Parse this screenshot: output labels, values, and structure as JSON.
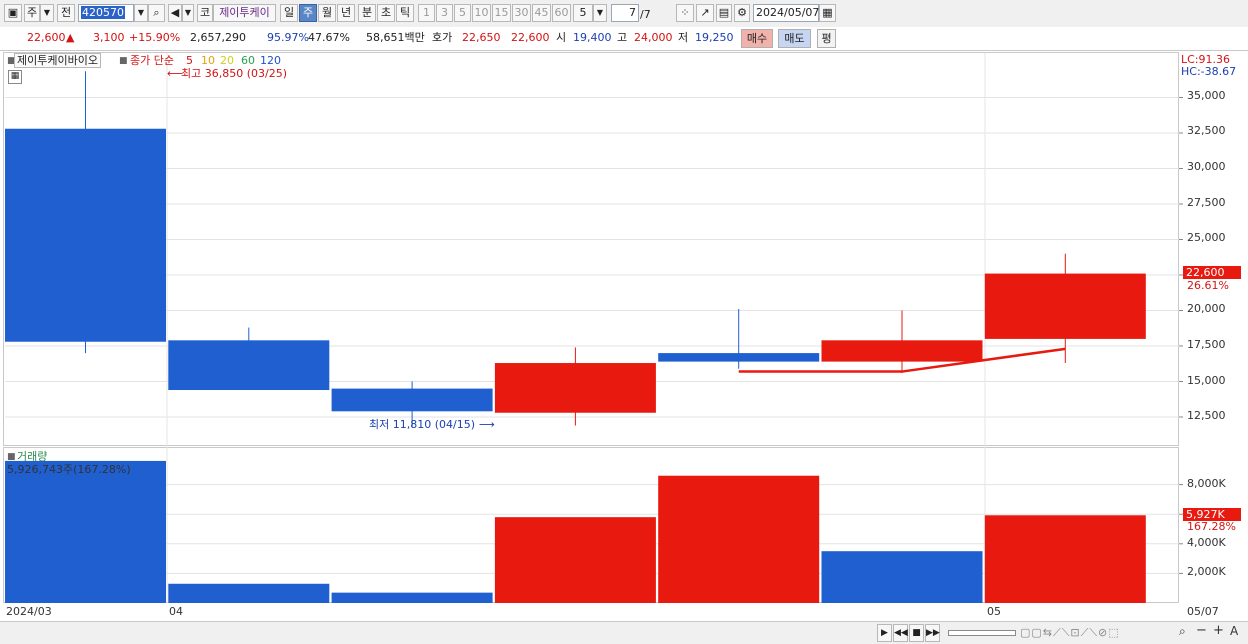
{
  "toolbar": {
    "period_week": "주",
    "all": "전",
    "code": "420570",
    "market": "코",
    "name": "제이투케이",
    "tabs": [
      "일",
      "주",
      "월",
      "년",
      "분",
      "초",
      "틱"
    ],
    "active_tab": "주",
    "intervals": [
      "1",
      "3",
      "5",
      "10",
      "15",
      "30",
      "45",
      "60"
    ],
    "interval_select": "5",
    "count": "7",
    "count_total": "/7",
    "date": "2024/05/07"
  },
  "quote": {
    "price": "22,600",
    "change": "3,100",
    "change_pct": "+15.90%",
    "volume": "2,657,290",
    "vol_ratio": "95.97%",
    "turnover": "47.67%",
    "amount": "58,651백만",
    "ask_label": "호가",
    "ask": "22,650",
    "bid": "22,600",
    "open_label": "시",
    "open": "19,400",
    "high_label": "고",
    "high": "24,000",
    "low_label": "저",
    "low": "19,250",
    "buy": "매수",
    "sell": "매도",
    "eval": "평"
  },
  "price_panel": {
    "stock_name": "제이투케이바이오",
    "ma_label": "종가 단순",
    "ma_periods": [
      "5",
      "10",
      "20",
      "60",
      "120"
    ],
    "high_note": "최고 36,850 (03/25)",
    "low_note": "최저 11,810 (04/15)",
    "lc": "LC:91.36",
    "hc": "HC:-38.67",
    "last_price_tag": "22,600",
    "last_pct_tag": "26.61%"
  },
  "volume_panel": {
    "title": "거래량",
    "value": "5,926,743주(167.28%)",
    "last_tag": "5,927K",
    "last_pct_tag": "167.28%"
  },
  "colors": {
    "up": "#e8190f",
    "down": "#1f5fd0",
    "ma5": "#e8190f"
  },
  "chart_data": [
    {
      "type": "candlestick",
      "x_labels": [
        "2024/03",
        "04",
        "05",
        "05/07"
      ],
      "ylim": [
        10000,
        37500
      ],
      "y_ticks": [
        "12,500",
        "15,000",
        "17,500",
        "20,000",
        "22,500",
        "25,000",
        "27,500",
        "30,000",
        "32,500",
        "35,000"
      ],
      "candles": [
        {
          "open": 32800,
          "close": 17800,
          "high": 36850,
          "low": 17000,
          "dir": "down"
        },
        {
          "open": 17900,
          "close": 14400,
          "high": 18800,
          "low": 14400,
          "dir": "down"
        },
        {
          "open": 14500,
          "close": 12900,
          "high": 15000,
          "low": 11810,
          "dir": "down"
        },
        {
          "open": 12800,
          "close": 16300,
          "high": 17400,
          "low": 11900,
          "dir": "up"
        },
        {
          "open": 17000,
          "close": 16400,
          "high": 20100,
          "low": 15900,
          "dir": "down"
        },
        {
          "open": 16400,
          "close": 17900,
          "high": 20000,
          "low": 15600,
          "dir": "up"
        },
        {
          "open": 18000,
          "close": 22600,
          "high": 24000,
          "low": 16300,
          "dir": "up"
        }
      ],
      "ma5": [
        15700,
        15700,
        17300
      ]
    },
    {
      "type": "bar",
      "ylim": [
        0,
        10000
      ],
      "y_ticks": [
        "2,000K",
        "4,000K",
        "6,000K",
        "8,000K"
      ],
      "values": [
        9600,
        1300,
        700,
        5800,
        8600,
        3500,
        5927
      ],
      "dirs": [
        "down",
        "down",
        "down",
        "up",
        "up",
        "down",
        "up"
      ]
    }
  ]
}
